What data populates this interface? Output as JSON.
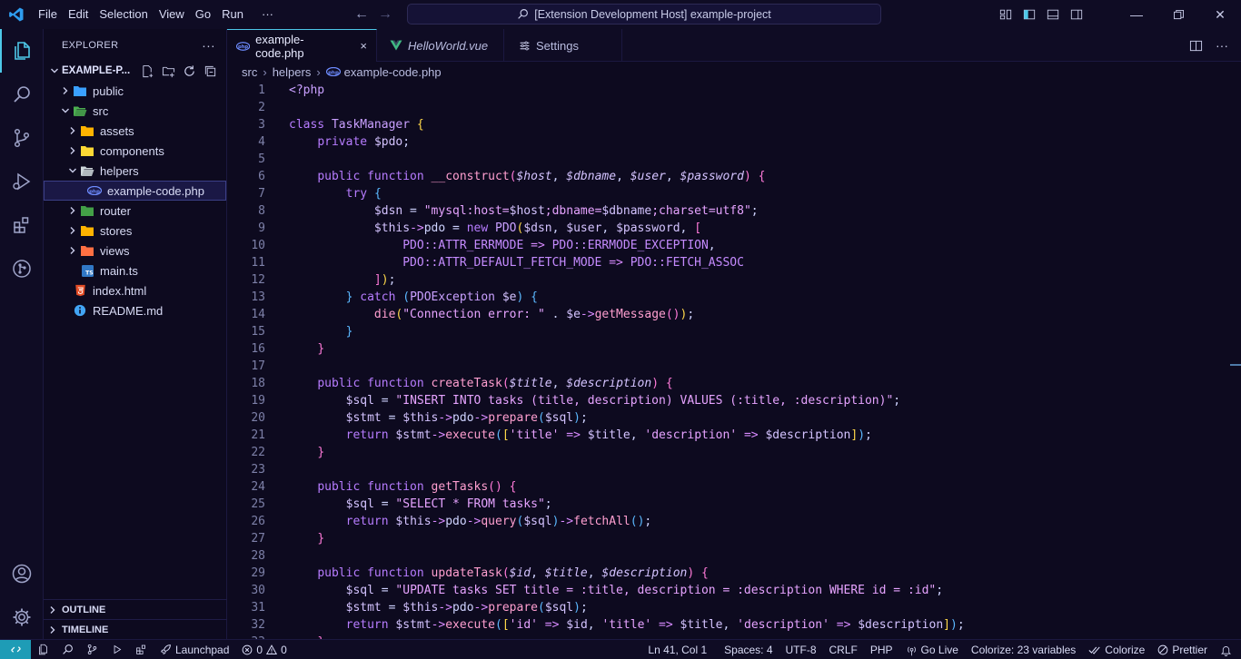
{
  "menu": [
    "File",
    "Edit",
    "Selection",
    "View",
    "Go",
    "Run",
    "···"
  ],
  "command_center": "[Extension Development Host] example-project",
  "explorer": {
    "title": "EXPLORER",
    "more": "···",
    "project": "EXAMPLE-P...",
    "tree": [
      {
        "label": "public",
        "type": "folder-closed",
        "depth": 0,
        "icon": "globe-folder-icon",
        "color": "#3aa0ff"
      },
      {
        "label": "src",
        "type": "folder-open",
        "depth": 0,
        "icon": "src-folder-icon",
        "color": "#4caf50"
      },
      {
        "label": "assets",
        "type": "folder-closed",
        "depth": 1,
        "icon": "assets-folder-icon",
        "color": "#ffb300"
      },
      {
        "label": "components",
        "type": "folder-closed",
        "depth": 1,
        "icon": "components-folder-icon",
        "color": "#fdd835"
      },
      {
        "label": "helpers",
        "type": "folder-open",
        "depth": 1,
        "icon": "helpers-folder-icon",
        "color": "#cfd8dc"
      },
      {
        "label": "example-code.php",
        "type": "file",
        "depth": 2,
        "icon": "php-file-icon",
        "color": "#6e8cff",
        "selected": true
      },
      {
        "label": "router",
        "type": "folder-closed",
        "depth": 1,
        "icon": "router-folder-icon",
        "color": "#43a047"
      },
      {
        "label": "stores",
        "type": "folder-closed",
        "depth": 1,
        "icon": "stores-folder-icon",
        "color": "#ffb300"
      },
      {
        "label": "views",
        "type": "folder-closed",
        "depth": 1,
        "icon": "views-folder-icon",
        "color": "#ff7043"
      },
      {
        "label": "main.ts",
        "type": "file",
        "depth": 1,
        "icon": "typescript-file-icon",
        "color": "#3178c6"
      },
      {
        "label": "index.html",
        "type": "file",
        "depth": 0,
        "icon": "html-file-icon",
        "color": "#e44d26"
      },
      {
        "label": "README.md",
        "type": "file",
        "depth": 0,
        "icon": "info-file-icon",
        "color": "#42a5f5"
      }
    ],
    "outline": "OUTLINE",
    "timeline": "TIMELINE"
  },
  "tabs": [
    {
      "label": "example-code.php",
      "icon": "php-file-icon",
      "active": true,
      "italic": false
    },
    {
      "label": "HelloWorld.vue",
      "icon": "vue-file-icon",
      "active": false,
      "italic": true
    },
    {
      "label": "Settings",
      "icon": "settings-icon",
      "active": false,
      "italic": false
    }
  ],
  "tab_close": "×",
  "breadcrumb": [
    "src",
    "helpers",
    "example-code.php"
  ],
  "code": [
    [
      [
        "c-tag",
        "<?php"
      ]
    ],
    [],
    [
      [
        "c-kw",
        "class "
      ],
      [
        "c-cls",
        "TaskManager "
      ],
      [
        "c-br",
        "{"
      ]
    ],
    [
      [
        "c-pl",
        "    "
      ],
      [
        "c-kw",
        "private "
      ],
      [
        "c-var",
        "$pdo"
      ],
      [
        "c-pl",
        ";"
      ]
    ],
    [],
    [
      [
        "c-pl",
        "    "
      ],
      [
        "c-kw",
        "public function "
      ],
      [
        "c-fn",
        "__construct"
      ],
      [
        "c-br2",
        "("
      ],
      [
        "c-var c-it",
        "$host"
      ],
      [
        "c-pl",
        ", "
      ],
      [
        "c-var c-it",
        "$dbname"
      ],
      [
        "c-pl",
        ", "
      ],
      [
        "c-var c-it",
        "$user"
      ],
      [
        "c-pl",
        ", "
      ],
      [
        "c-var c-it",
        "$password"
      ],
      [
        "c-br2",
        ") {"
      ]
    ],
    [
      [
        "c-pl",
        "        "
      ],
      [
        "c-kw",
        "try "
      ],
      [
        "c-br3",
        "{"
      ]
    ],
    [
      [
        "c-pl",
        "            "
      ],
      [
        "c-var",
        "$dsn"
      ],
      [
        "c-pl",
        " = "
      ],
      [
        "c-str",
        "\"mysql:host="
      ],
      [
        "c-var",
        "$host"
      ],
      [
        "c-str",
        ";dbname="
      ],
      [
        "c-var",
        "$dbname"
      ],
      [
        "c-str",
        ";charset=utf8\""
      ],
      [
        "c-pl",
        ";"
      ]
    ],
    [
      [
        "c-pl",
        "            "
      ],
      [
        "c-var",
        "$this"
      ],
      [
        "c-op",
        "->"
      ],
      [
        "c-pl",
        "pdo = "
      ],
      [
        "c-kw",
        "new "
      ],
      [
        "c-cls",
        "PDO"
      ],
      [
        "c-br",
        "("
      ],
      [
        "c-var",
        "$dsn"
      ],
      [
        "c-pl",
        ", "
      ],
      [
        "c-var",
        "$user"
      ],
      [
        "c-pl",
        ", "
      ],
      [
        "c-var",
        "$password"
      ],
      [
        "c-pl",
        ", "
      ],
      [
        "c-br2",
        "["
      ]
    ],
    [
      [
        "c-pl",
        "                "
      ],
      [
        "c-const",
        "PDO::ATTR_ERRMODE "
      ],
      [
        "c-op",
        "=> "
      ],
      [
        "c-const",
        "PDO::ERRMODE_EXCEPTION"
      ],
      [
        "c-pl",
        ","
      ]
    ],
    [
      [
        "c-pl",
        "                "
      ],
      [
        "c-const",
        "PDO::ATTR_DEFAULT_FETCH_MODE "
      ],
      [
        "c-op",
        "=> "
      ],
      [
        "c-const",
        "PDO::FETCH_ASSOC"
      ]
    ],
    [
      [
        "c-pl",
        "            "
      ],
      [
        "c-br2",
        "]"
      ],
      [
        "c-br",
        ")"
      ],
      [
        "c-pl",
        ";"
      ]
    ],
    [
      [
        "c-pl",
        "        "
      ],
      [
        "c-br3",
        "} "
      ],
      [
        "c-kw",
        "catch "
      ],
      [
        "c-br3",
        "("
      ],
      [
        "c-cls",
        "PDOException "
      ],
      [
        "c-var",
        "$e"
      ],
      [
        "c-br3",
        ") {"
      ]
    ],
    [
      [
        "c-pl",
        "            "
      ],
      [
        "c-fn",
        "die"
      ],
      [
        "c-br",
        "("
      ],
      [
        "c-str",
        "\"Connection error: \""
      ],
      [
        "c-pl",
        " . "
      ],
      [
        "c-var",
        "$e"
      ],
      [
        "c-op",
        "->"
      ],
      [
        "c-fn",
        "getMessage"
      ],
      [
        "c-br2",
        "()"
      ],
      [
        "c-br",
        ")"
      ],
      [
        "c-pl",
        ";"
      ]
    ],
    [
      [
        "c-pl",
        "        "
      ],
      [
        "c-br3",
        "}"
      ]
    ],
    [
      [
        "c-pl",
        "    "
      ],
      [
        "c-br2",
        "}"
      ]
    ],
    [],
    [
      [
        "c-pl",
        "    "
      ],
      [
        "c-kw",
        "public function "
      ],
      [
        "c-fn",
        "createTask"
      ],
      [
        "c-br2",
        "("
      ],
      [
        "c-var c-it",
        "$title"
      ],
      [
        "c-pl",
        ", "
      ],
      [
        "c-var c-it",
        "$description"
      ],
      [
        "c-br2",
        ") {"
      ]
    ],
    [
      [
        "c-pl",
        "        "
      ],
      [
        "c-var",
        "$sql"
      ],
      [
        "c-pl",
        " = "
      ],
      [
        "c-str",
        "\"INSERT INTO tasks (title, description) VALUES (:title, :description)\""
      ],
      [
        "c-pl",
        ";"
      ]
    ],
    [
      [
        "c-pl",
        "        "
      ],
      [
        "c-var",
        "$stmt"
      ],
      [
        "c-pl",
        " = "
      ],
      [
        "c-var",
        "$this"
      ],
      [
        "c-op",
        "->"
      ],
      [
        "c-pl",
        "pdo"
      ],
      [
        "c-op",
        "->"
      ],
      [
        "c-fn",
        "prepare"
      ],
      [
        "c-br3",
        "("
      ],
      [
        "c-var",
        "$sql"
      ],
      [
        "c-br3",
        ")"
      ],
      [
        "c-pl",
        ";"
      ]
    ],
    [
      [
        "c-pl",
        "        "
      ],
      [
        "c-kw",
        "return "
      ],
      [
        "c-var",
        "$stmt"
      ],
      [
        "c-op",
        "->"
      ],
      [
        "c-fn",
        "execute"
      ],
      [
        "c-br3",
        "("
      ],
      [
        "c-br",
        "["
      ],
      [
        "c-str",
        "'title'"
      ],
      [
        "c-op",
        " => "
      ],
      [
        "c-var",
        "$title"
      ],
      [
        "c-pl",
        ", "
      ],
      [
        "c-str",
        "'description'"
      ],
      [
        "c-op",
        " => "
      ],
      [
        "c-var",
        "$description"
      ],
      [
        "c-br",
        "]"
      ],
      [
        "c-br3",
        ")"
      ],
      [
        "c-pl",
        ";"
      ]
    ],
    [
      [
        "c-pl",
        "    "
      ],
      [
        "c-br2",
        "}"
      ]
    ],
    [],
    [
      [
        "c-pl",
        "    "
      ],
      [
        "c-kw",
        "public function "
      ],
      [
        "c-fn",
        "getTasks"
      ],
      [
        "c-br2",
        "() {"
      ]
    ],
    [
      [
        "c-pl",
        "        "
      ],
      [
        "c-var",
        "$sql"
      ],
      [
        "c-pl",
        " = "
      ],
      [
        "c-str",
        "\"SELECT * FROM tasks\""
      ],
      [
        "c-pl",
        ";"
      ]
    ],
    [
      [
        "c-pl",
        "        "
      ],
      [
        "c-kw",
        "return "
      ],
      [
        "c-var",
        "$this"
      ],
      [
        "c-op",
        "->"
      ],
      [
        "c-pl",
        "pdo"
      ],
      [
        "c-op",
        "->"
      ],
      [
        "c-fn",
        "query"
      ],
      [
        "c-br3",
        "("
      ],
      [
        "c-var",
        "$sql"
      ],
      [
        "c-br3",
        ")"
      ],
      [
        "c-op",
        "->"
      ],
      [
        "c-fn",
        "fetchAll"
      ],
      [
        "c-br3",
        "()"
      ],
      [
        "c-pl",
        ";"
      ]
    ],
    [
      [
        "c-pl",
        "    "
      ],
      [
        "c-br2",
        "}"
      ]
    ],
    [],
    [
      [
        "c-pl",
        "    "
      ],
      [
        "c-kw",
        "public function "
      ],
      [
        "c-fn",
        "updateTask"
      ],
      [
        "c-br2",
        "("
      ],
      [
        "c-var c-it",
        "$id"
      ],
      [
        "c-pl",
        ", "
      ],
      [
        "c-var c-it",
        "$title"
      ],
      [
        "c-pl",
        ", "
      ],
      [
        "c-var c-it",
        "$description"
      ],
      [
        "c-br2",
        ") {"
      ]
    ],
    [
      [
        "c-pl",
        "        "
      ],
      [
        "c-var",
        "$sql"
      ],
      [
        "c-pl",
        " = "
      ],
      [
        "c-str",
        "\"UPDATE tasks SET title = :title, description = :description WHERE id = :id\""
      ],
      [
        "c-pl",
        ";"
      ]
    ],
    [
      [
        "c-pl",
        "        "
      ],
      [
        "c-var",
        "$stmt"
      ],
      [
        "c-pl",
        " = "
      ],
      [
        "c-var",
        "$this"
      ],
      [
        "c-op",
        "->"
      ],
      [
        "c-pl",
        "pdo"
      ],
      [
        "c-op",
        "->"
      ],
      [
        "c-fn",
        "prepare"
      ],
      [
        "c-br3",
        "("
      ],
      [
        "c-var",
        "$sql"
      ],
      [
        "c-br3",
        ")"
      ],
      [
        "c-pl",
        ";"
      ]
    ],
    [
      [
        "c-pl",
        "        "
      ],
      [
        "c-kw",
        "return "
      ],
      [
        "c-var",
        "$stmt"
      ],
      [
        "c-op",
        "->"
      ],
      [
        "c-fn",
        "execute"
      ],
      [
        "c-br3",
        "("
      ],
      [
        "c-br",
        "["
      ],
      [
        "c-str",
        "'id'"
      ],
      [
        "c-op",
        " => "
      ],
      [
        "c-var",
        "$id"
      ],
      [
        "c-pl",
        ", "
      ],
      [
        "c-str",
        "'title'"
      ],
      [
        "c-op",
        " => "
      ],
      [
        "c-var",
        "$title"
      ],
      [
        "c-pl",
        ", "
      ],
      [
        "c-str",
        "'description'"
      ],
      [
        "c-op",
        " => "
      ],
      [
        "c-var",
        "$description"
      ],
      [
        "c-br",
        "]"
      ],
      [
        "c-br3",
        ")"
      ],
      [
        "c-pl",
        ";"
      ]
    ],
    [
      [
        "c-pl",
        "    "
      ],
      [
        "c-br2",
        "}"
      ]
    ]
  ],
  "status": {
    "launchpad": "Launchpad",
    "errors": "0",
    "warnings": "0",
    "position": "Ln 41, Col 1",
    "spaces": "Spaces: 4",
    "encoding": "UTF-8",
    "eol": "CRLF",
    "language": "PHP",
    "golive": "Go Live",
    "colorize_vars": "Colorize: 23 variables",
    "colorize": "Colorize",
    "prettier": "Prettier"
  },
  "colors": {
    "accent": "#4ec8e8",
    "background": "#0d0a1f",
    "remote": "#1e9cb6"
  }
}
